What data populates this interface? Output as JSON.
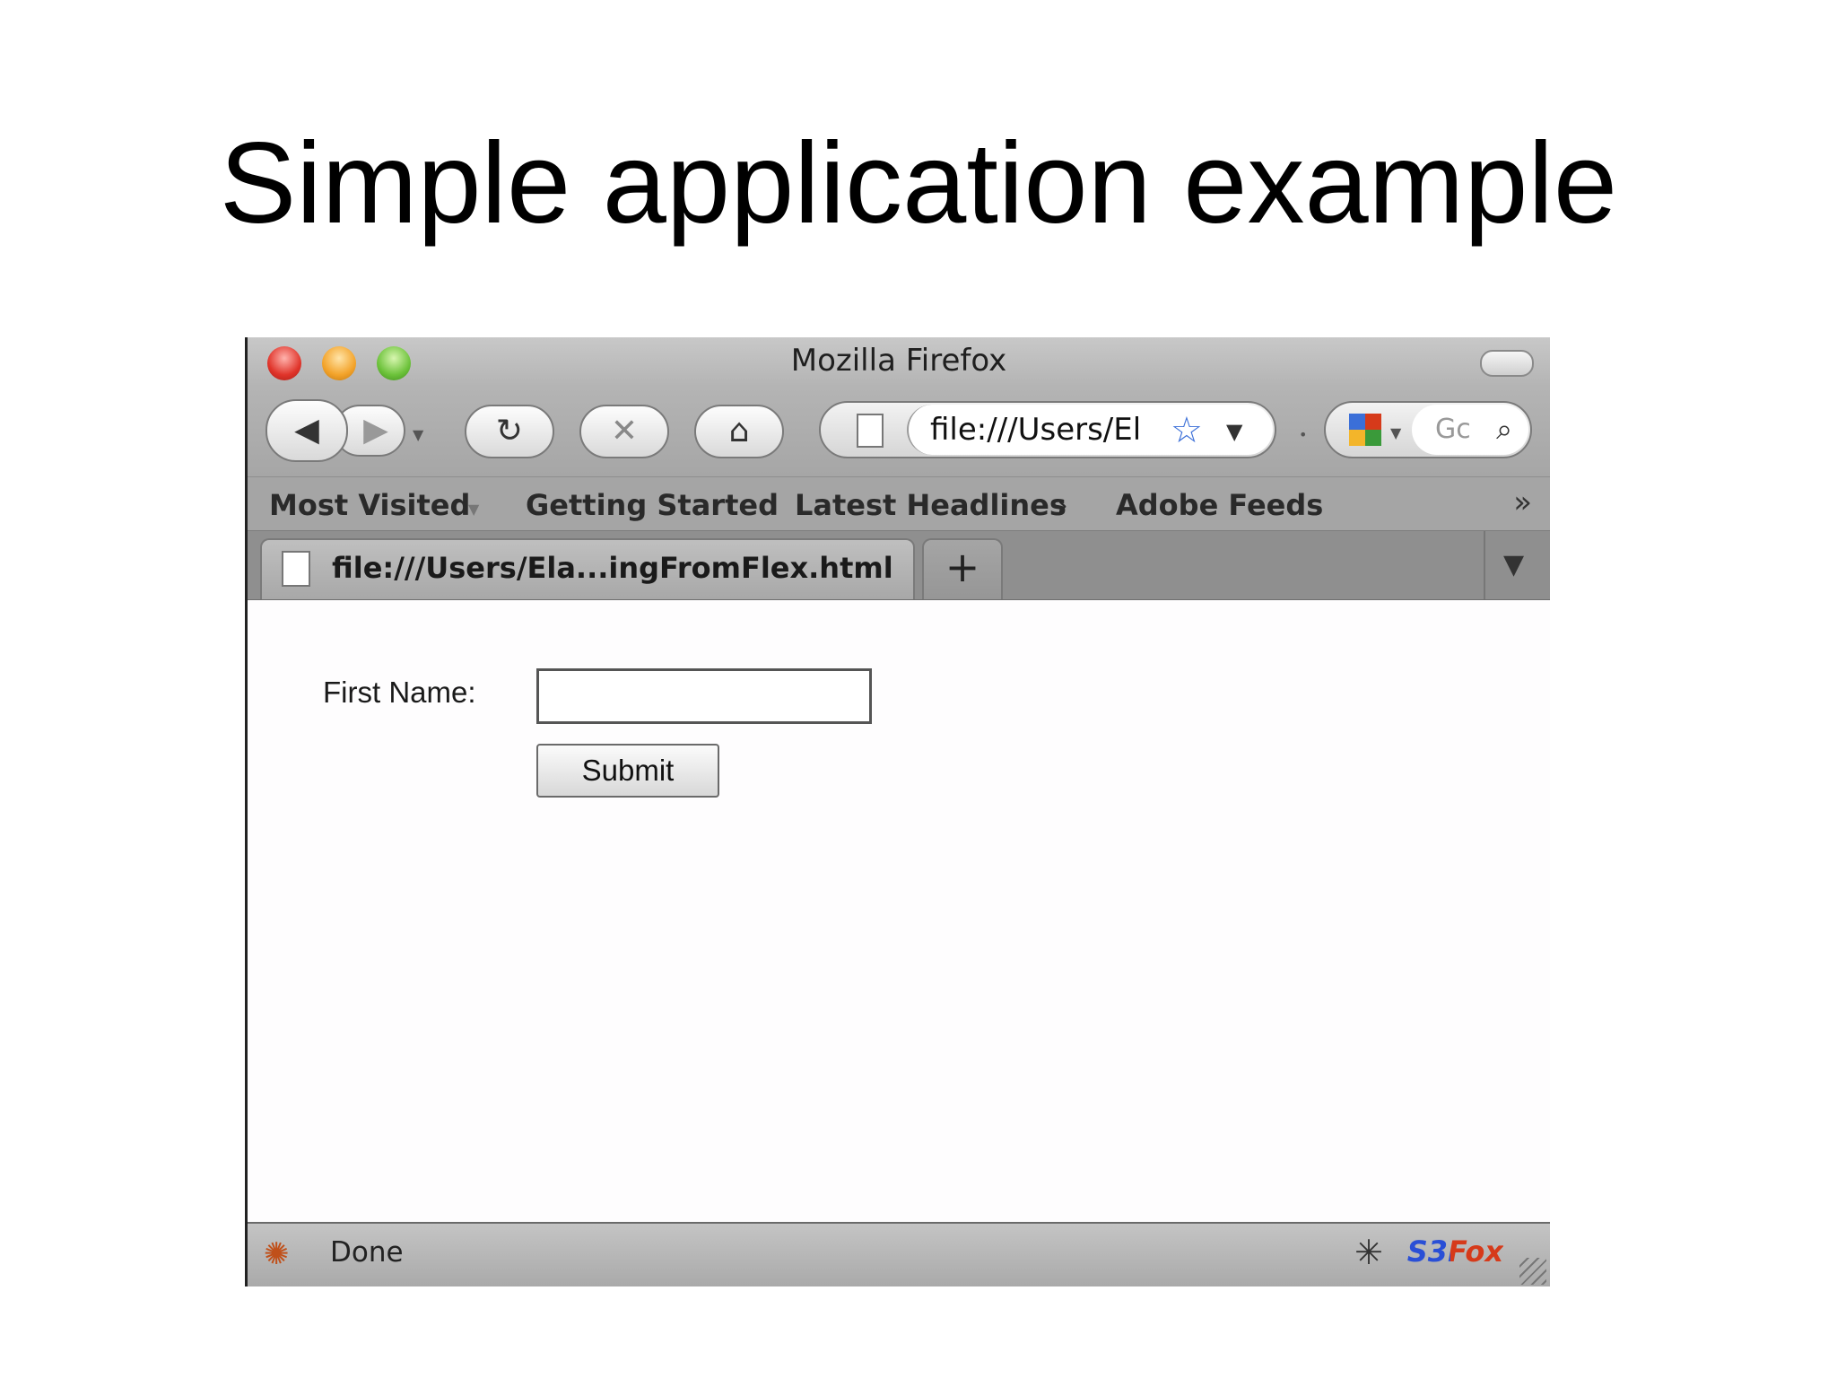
{
  "slide": {
    "title": "Simple application example"
  },
  "window": {
    "title": "Mozilla Firefox"
  },
  "toolbar": {
    "back_icon": "back-arrow-icon",
    "forward_icon": "forward-arrow-icon",
    "reload_icon": "reload-icon",
    "stop_icon": "stop-icon",
    "home_icon": "home-icon",
    "url": "file:///Users/El",
    "search_placeholder": "Gc"
  },
  "bookmarks": [
    "Most Visited",
    "Getting Started",
    "Latest Headlines",
    "Adobe Feeds"
  ],
  "tab": {
    "label": "file:///Users/Ela...ingFromFlex.html",
    "new_tab": "+"
  },
  "form": {
    "label": "First Name:",
    "value": "",
    "submit": "Submit"
  },
  "status": {
    "text": "Done",
    "addon": "S3Fox"
  },
  "colors": {
    "star": "#3b6fd8",
    "addon_s3": "#2a4fd6",
    "addon_fox": "#d63a1a"
  }
}
